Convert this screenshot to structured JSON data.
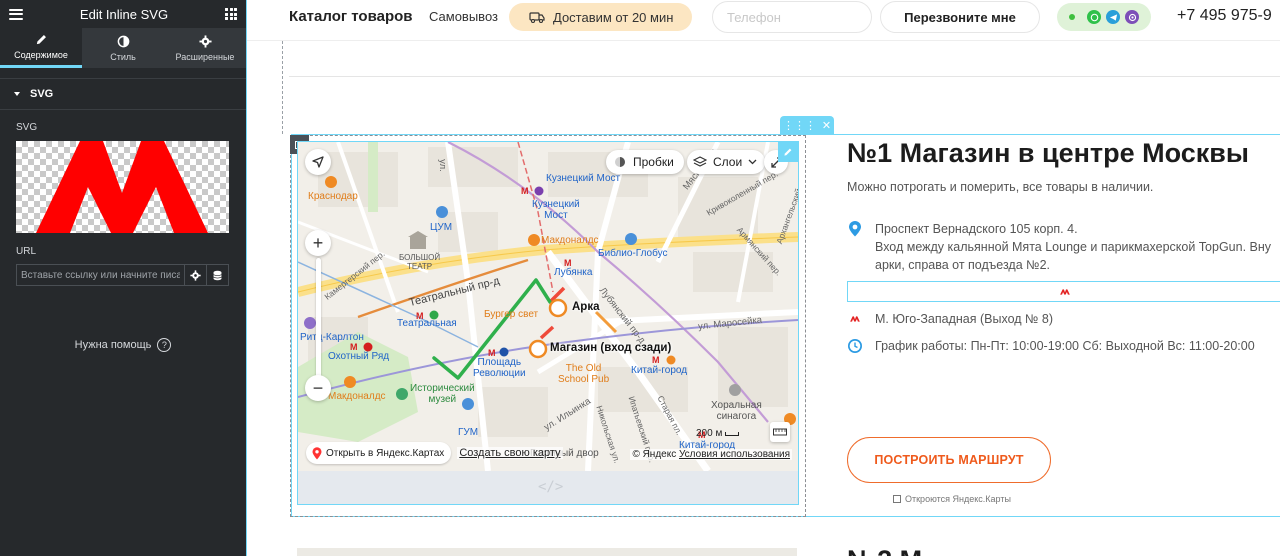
{
  "editor": {
    "title": "Edit Inline SVG",
    "tabs": [
      {
        "label": "Содержимое",
        "icon": "pencil-icon"
      },
      {
        "label": "Стиль",
        "icon": "half-circle-icon"
      },
      {
        "label": "Расширенные",
        "icon": "gear-icon"
      }
    ],
    "section_title": "SVG",
    "svg_label": "SVG",
    "url_label": "URL",
    "url_placeholder": "Вставьте ссылку или начните писать",
    "url_value": "",
    "help_label": "Нужна помощь",
    "preview_color": "#ff0000"
  },
  "header": {
    "logo": "Каталог товаров",
    "pickup": "Самовывоз",
    "delivery": "Доставим от 20 мин",
    "phone_placeholder": "Телефон",
    "callback_label": "Перезвоните мне",
    "phone_number": "+7 495 975-9",
    "delivery_bg": "#fce6c2",
    "messengers_bg": "#dff2d8"
  },
  "map": {
    "traffic_label": "Пробки",
    "layers_label": "Слои",
    "open_label": "Открыть в Яндекс.Картах",
    "create_label": "Создать свою карту",
    "copyright": "© Яндекс",
    "terms": "Условия использования",
    "scale": "200 м",
    "arch_label": "Арка",
    "shop_label": "Магазин (вход сзади)",
    "labels": {
      "kuznetsky_most_street": "Кузнецкий Мост",
      "kuznetsky_most_metro": "Кузнецкий\nМост",
      "krasnodar": "Краснодар",
      "tsum": "ЦУМ",
      "mcdonalds1": "Макдоналдс",
      "biblio": "Библио-Глобус",
      "bolshoi": "БОЛЬШОЙ\nТЕАТР",
      "teatralny_proezd": "Театральный пр-д",
      "lubyanka": "Лубянка",
      "teatralnaya": "Театральная",
      "burger": "Бургер свет",
      "okhotny": "Охотный Ряд",
      "ploshchad": "Площадь\nРеволюции",
      "maroseyka": "ул. Маросейка",
      "kitai_gorod": "Китай-город",
      "old_school": "The Old\nSchool Pub",
      "istorichesky": "Исторический\nмузей",
      "mcdonalds2": "Макдоналдс",
      "gum": "ГУМ",
      "ilyinka": "ул. Ильинка",
      "khoralnaya": "Хоральная\nсинагога",
      "kitai_gorod2": "Китай-город",
      "gostiny": "Гостиный двор",
      "lubyansky_proezd": "Лубянский пр-д",
      "kamergersky": "Камергерский пер.",
      "myasnitskaya": "Мясницкая",
      "arkhangelsky": "Архангельский пер.",
      "krivokolenny": "Кривоколенный пер.",
      "armyansky": "Армянский пер.",
      "nikolskaya": "Никольская ул.",
      "ipatyevsky": "Ипатьевский пер.",
      "staraya": "Старая пл.",
      "karlton": "Ритц-Карлтон",
      "neglinnaya": "ул."
    }
  },
  "shop": {
    "title": "№1 Магазин в центре Москвы",
    "description": "Можно потрогать и померить, все товары в наличии.",
    "address_line1": "Проспект Вернадского 105 корп. 4.",
    "address_line2": "Вход между кальянной Мята Lounge и парикмахерской TopGun. Вну",
    "address_line3": "арки, справа от подъезда №2.",
    "metro": "М. Юго-Западная (Выход № 8)",
    "hours": "График работы: Пн-Пт: 10:00-19:00 Сб: Выходной Вс: 11:00-20:00",
    "route_button": "ПОСТРОИТЬ МАРШРУТ",
    "route_note": "Откроются Яндекс.Карты",
    "accent_color": "#ef5a1c",
    "icon_color": "#2d9be3"
  },
  "next_shop": {
    "title": "№2 М"
  }
}
